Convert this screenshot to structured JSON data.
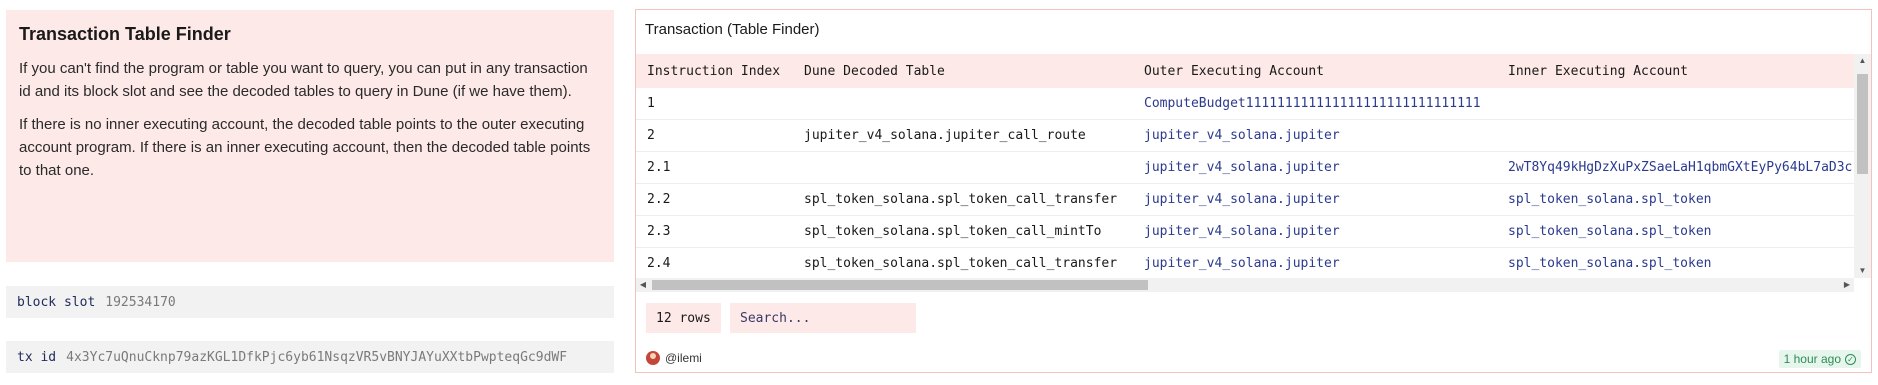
{
  "text_panel": {
    "title": "Transaction Table Finder",
    "paragraphs": [
      "If you can't find the program or table you want to query, you can put in any transaction id and its block slot and see the decoded tables to query in Dune (if we have them).",
      "If there is no inner executing account, the decoded table points to the outer executing account program. If there is an inner executing account, then the decoded table points to that one."
    ]
  },
  "params": {
    "block_slot": {
      "name": "block slot",
      "value": "192534170"
    },
    "tx_id": {
      "name": "tx id",
      "value": "4x3Yc7uQnuCknp79azKGL1DfkPjc6yb61NsqzVR5vBNYJAYuXXtbPwpteqGc9dWF"
    }
  },
  "table": {
    "title": "Transaction (Table Finder)",
    "columns": [
      "Instruction Index",
      "Dune Decoded Table",
      "Outer Executing Account",
      "Inner Executing Account"
    ],
    "rows": [
      [
        "1",
        "",
        "ComputeBudget111111111111111111111111111111",
        ""
      ],
      [
        "2",
        "jupiter_v4_solana.jupiter_call_route",
        "jupiter_v4_solana.jupiter",
        ""
      ],
      [
        "2.1",
        "",
        "jupiter_v4_solana.jupiter",
        "2wT8Yq49kHgDzXuPxZSaeLaH1qbmGXtEyPy64bL7aD3c"
      ],
      [
        "2.2",
        "spl_token_solana.spl_token_call_transfer",
        "jupiter_v4_solana.jupiter",
        "spl_token_solana.spl_token"
      ],
      [
        "2.3",
        "spl_token_solana.spl_token_call_mintTo",
        "jupiter_v4_solana.jupiter",
        "spl_token_solana.spl_token"
      ],
      [
        "2.4",
        "spl_token_solana.spl_token_call_transfer",
        "jupiter_v4_solana.jupiter",
        "spl_token_solana.spl_token"
      ]
    ],
    "row_count": "12 rows",
    "search_placeholder": "Search...",
    "author": "@ilemi",
    "timestamp": "1 hour ago"
  },
  "colors": {
    "accent_bg": "#fde9e7",
    "link": "#2b3a8f",
    "success": "#2e8b57"
  },
  "icons": [
    "avatar-icon",
    "check-circle-icon",
    "arrow-up-icon",
    "arrow-down-icon",
    "arrow-left-icon",
    "arrow-right-icon"
  ]
}
